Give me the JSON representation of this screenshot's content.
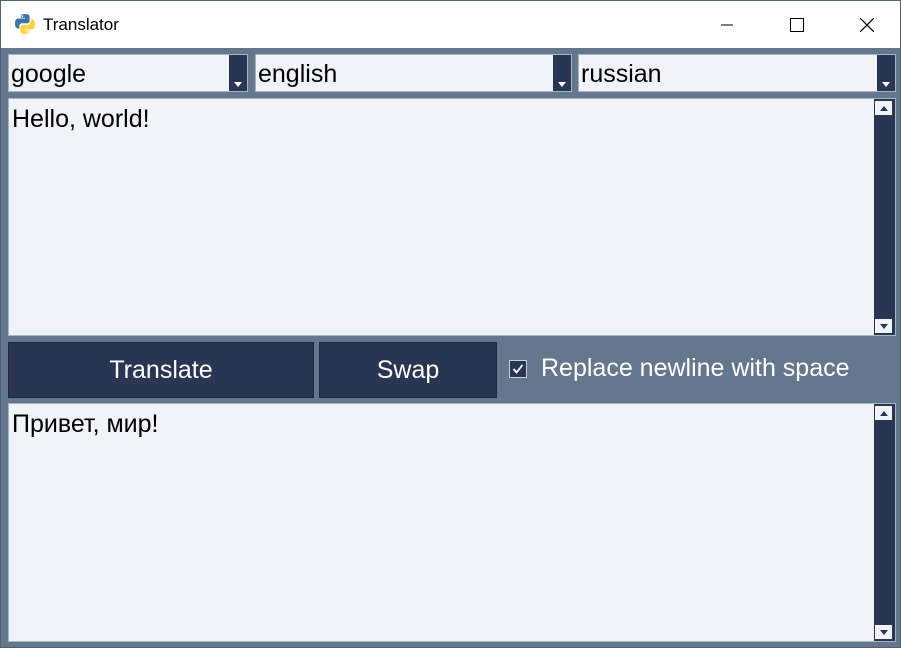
{
  "window": {
    "title": "Translator",
    "controls": [
      "minimize-icon",
      "maximize-icon",
      "close-icon"
    ]
  },
  "toolbar": {
    "engine": "google",
    "source_lang": "english",
    "target_lang": "russian"
  },
  "input": {
    "text": "Hello, world!"
  },
  "actions": {
    "translate_label": "Translate",
    "swap_label": "Swap",
    "newline_checkbox_label": "Replace newline with space",
    "newline_checkbox_checked": true
  },
  "output": {
    "text": "Привет, мир!"
  },
  "colors": {
    "background": "#64778d",
    "control_dark": "#283654",
    "field": "#f0f3f8"
  }
}
